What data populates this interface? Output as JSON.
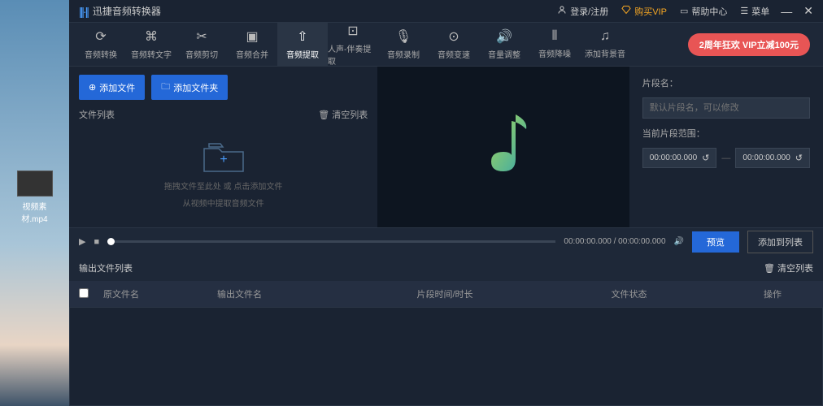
{
  "desktop": {
    "file_name": "视频素材.mp4"
  },
  "titlebar": {
    "app_title": "迅捷音频转换器",
    "login": "登录/注册",
    "buy_vip": "购买VIP",
    "help": "帮助中心",
    "menu": "菜单"
  },
  "toolbar": {
    "items": [
      {
        "label": "音频转换"
      },
      {
        "label": "音频转文字"
      },
      {
        "label": "音频剪切"
      },
      {
        "label": "音频合并"
      },
      {
        "label": "音频提取"
      },
      {
        "label": "人声-伴奏提取"
      },
      {
        "label": "音频录制"
      },
      {
        "label": "音频变速"
      },
      {
        "label": "音量调整"
      },
      {
        "label": "音频降噪"
      },
      {
        "label": "添加背景音"
      }
    ],
    "promo": "2周年狂欢 VIP立减100元"
  },
  "left": {
    "add_file": "添加文件",
    "add_folder": "添加文件夹",
    "file_list": "文件列表",
    "clear_list": "清空列表",
    "drop_hint1": "拖拽文件至此处 或 点击添加文件",
    "drop_hint2": "从视频中提取音频文件"
  },
  "right": {
    "seg_name": "片段名：",
    "seg_placeholder": "默认片段名，可以修改",
    "cur_range": "当前片段范围：",
    "t_start": "00:00:00.000",
    "t_end": "00:00:00.000"
  },
  "player": {
    "cur": "00:00:00.000",
    "total": "00:00:00.000",
    "sep": " / ",
    "preview": "预览",
    "add_to_list": "添加到列表"
  },
  "output": {
    "title": "输出文件列表",
    "clear": "清空列表",
    "cols": {
      "c1": "原文件名",
      "c2": "输出文件名",
      "c3": "片段时间/时长",
      "c4": "文件状态",
      "c5": "操作"
    }
  }
}
